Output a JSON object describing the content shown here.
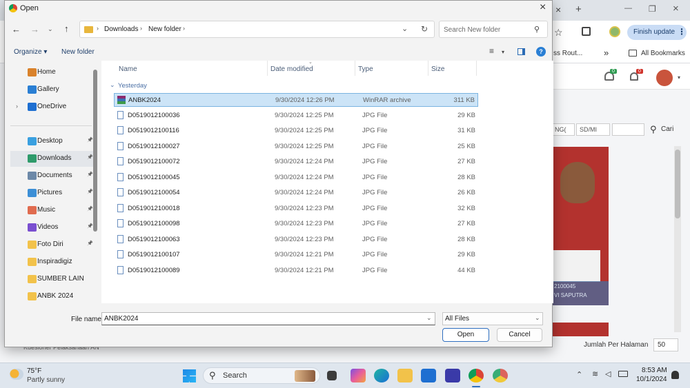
{
  "browser": {
    "tab_controls": {
      "close": "×",
      "new_tab": "+",
      "minimize": "—",
      "restore": "❐",
      "close_window": "×"
    },
    "finish_update": "Finish update",
    "bookmarks": {
      "item1": "ss Rout...",
      "more": "»",
      "all_bookmarks": "All Bookmarks"
    },
    "page": {
      "filters": [
        "NG(",
        "SD/MI"
      ],
      "search_button": "Cari",
      "photo_caption_line1": "2100045",
      "photo_caption_line2": "VI SAPUTRA",
      "per_page_label": "Jumlah Per Halaman",
      "per_page_value": "50",
      "bottom_item": "Kuesioner Pelaksanaan AN",
      "badge_messages": "0",
      "badge_notifications": "0"
    }
  },
  "dialog": {
    "title": "Open",
    "close": "×",
    "breadcrumb": [
      "Downloads",
      "New folder"
    ],
    "search_placeholder": "Search New folder",
    "organize_label": "Organize",
    "new_folder_label": "New folder",
    "help": "?",
    "columns": {
      "name": "Name",
      "date": "Date modified",
      "type": "Type",
      "size": "Size"
    },
    "group_label": "Yesterday",
    "files": [
      {
        "name": "ANBK2024",
        "date": "9/30/2024 12:26 PM",
        "type": "WinRAR archive",
        "size": "311 KB"
      },
      {
        "name": "D0519012100036",
        "date": "9/30/2024 12:25 PM",
        "type": "JPG File",
        "size": "29 KB"
      },
      {
        "name": "D0519012100116",
        "date": "9/30/2024 12:25 PM",
        "type": "JPG File",
        "size": "31 KB"
      },
      {
        "name": "D0519012100027",
        "date": "9/30/2024 12:25 PM",
        "type": "JPG File",
        "size": "25 KB"
      },
      {
        "name": "D0519012100072",
        "date": "9/30/2024 12:24 PM",
        "type": "JPG File",
        "size": "27 KB"
      },
      {
        "name": "D0519012100045",
        "date": "9/30/2024 12:24 PM",
        "type": "JPG File",
        "size": "28 KB"
      },
      {
        "name": "D0519012100054",
        "date": "9/30/2024 12:24 PM",
        "type": "JPG File",
        "size": "26 KB"
      },
      {
        "name": "D0519012100018",
        "date": "9/30/2024 12:23 PM",
        "type": "JPG File",
        "size": "32 KB"
      },
      {
        "name": "D0519012100098",
        "date": "9/30/2024 12:23 PM",
        "type": "JPG File",
        "size": "27 KB"
      },
      {
        "name": "D0519012100063",
        "date": "9/30/2024 12:23 PM",
        "type": "JPG File",
        "size": "28 KB"
      },
      {
        "name": "D0519012100107",
        "date": "9/30/2024 12:21 PM",
        "type": "JPG File",
        "size": "29 KB"
      },
      {
        "name": "D0519012100089",
        "date": "9/30/2024 12:21 PM",
        "type": "JPG File",
        "size": "44 KB"
      }
    ],
    "nav": [
      {
        "label": "Home",
        "icon": "home-icon",
        "color": "#d9822b"
      },
      {
        "label": "Gallery",
        "icon": "gallery-icon",
        "color": "#2a7fd4"
      },
      {
        "label": "OneDrive",
        "icon": "onedrive-icon",
        "color": "#1e6fd1"
      },
      {
        "label": "Desktop",
        "icon": "desktop-icon",
        "color": "#3aa0e0"
      },
      {
        "label": "Downloads",
        "icon": "downloads-icon",
        "color": "#2f9b6b"
      },
      {
        "label": "Documents",
        "icon": "documents-icon",
        "color": "#6d89a8"
      },
      {
        "label": "Pictures",
        "icon": "pictures-icon",
        "color": "#3c8fd6"
      },
      {
        "label": "Music",
        "icon": "music-icon",
        "color": "#e06b4f"
      },
      {
        "label": "Videos",
        "icon": "videos-icon",
        "color": "#7a4fd0"
      },
      {
        "label": "Foto Diri",
        "icon": "folder-icon",
        "color": "#f2c24a"
      },
      {
        "label": "Inspiradigiz",
        "icon": "folder-icon",
        "color": "#f2c24a"
      },
      {
        "label": "SUMBER LAIN",
        "icon": "folder-icon",
        "color": "#f2c24a"
      },
      {
        "label": "ANBK 2024",
        "icon": "folder-icon",
        "color": "#f2c24a"
      }
    ],
    "filename_label": "File name:",
    "filename_value": "ANBK2024",
    "filetype_value": "All Files",
    "open_button": "Open",
    "cancel_button": "Cancel"
  },
  "taskbar": {
    "weather_temp": "75°F",
    "weather_desc": "Partly sunny",
    "search_label": "Search",
    "time": "8:53 AM",
    "date": "10/1/2024"
  }
}
